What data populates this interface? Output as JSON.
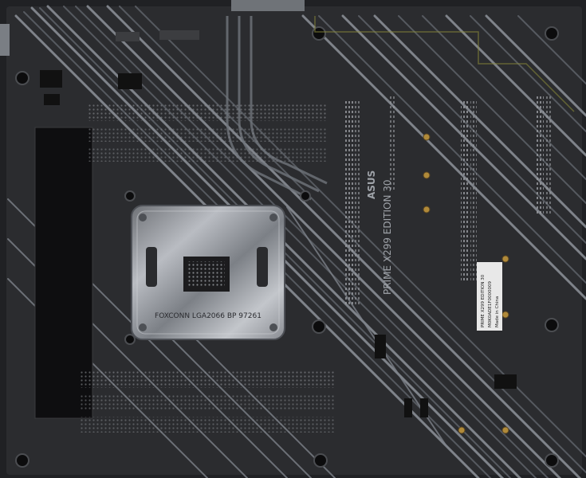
{
  "socket_marking": "FOXCONN  LGA2066  BP  97261",
  "brand_logo": "ASUS",
  "model_marking": "PRIME X299 EDITION 30",
  "sticker": {
    "line1": "PRIME X299 EDITION 30",
    "line2": "M0K0ADE1F0000009",
    "line3": "Made in China"
  },
  "colors": {
    "pcb": "#2b2c2f",
    "trace_light": "#8e939a",
    "trace_dark": "#4a4d53",
    "plate": "#9a9ea5",
    "gold": "#b08a3a"
  }
}
